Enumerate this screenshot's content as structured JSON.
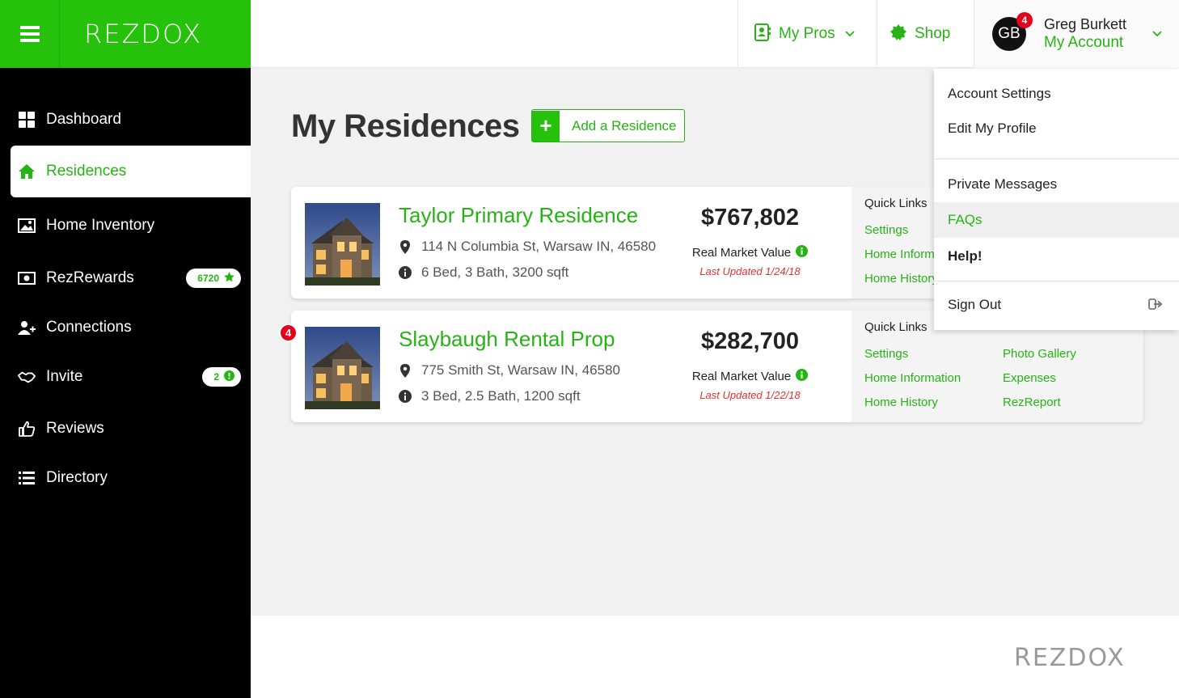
{
  "brand": {
    "logo": "REZDOX"
  },
  "header": {
    "my_pros": "My Pros",
    "shop": "Shop",
    "account": {
      "initials": "GB",
      "badge": "4",
      "name": "Greg Burkett",
      "sub": "My Account"
    }
  },
  "sidebar": {
    "items": [
      {
        "label": "Dashboard",
        "icon": "grid-icon"
      },
      {
        "label": "Residences",
        "icon": "home-icon",
        "active": true
      },
      {
        "label": "Home Inventory",
        "icon": "image-icon"
      },
      {
        "label": "RezRewards",
        "icon": "money-icon",
        "badge": "6720"
      },
      {
        "label": "Connections",
        "icon": "user-plus-icon"
      },
      {
        "label": "Invite",
        "icon": "handshake-icon",
        "badge": "2"
      },
      {
        "label": "Reviews",
        "icon": "thumbs-up-icon"
      },
      {
        "label": "Directory",
        "icon": "list-icon"
      }
    ]
  },
  "main": {
    "title": "My Residences",
    "add_button": "Add a Residence",
    "residences": [
      {
        "name": "Taylor Primary Residence",
        "address": "114 N Columbia St, Warsaw IN, 46580",
        "details": "6 Bed, 3 Bath, 3200 sqft",
        "price": "$767,802",
        "value_label": "Real Market Value",
        "updated": "Last Updated 1/24/18",
        "quick_links_title": "Quick Links",
        "links": [
          "Settings",
          "Home Inform",
          "Home History"
        ]
      },
      {
        "name": "Slaybaugh Rental Prop",
        "address": "775 Smith St, Warsaw IN, 46580",
        "details": "3 Bed, 2.5 Bath, 1200 sqft",
        "price": "$282,700",
        "value_label": "Real Market Value",
        "updated": "Last Updated 1/22/18",
        "quick_links_title": "Quick Links",
        "links": [
          "Settings",
          "Home Information",
          "Home History",
          "Photo Gallery",
          "Expenses",
          "RezReport"
        ],
        "notification": "4"
      }
    ]
  },
  "dropdown": {
    "items": [
      "Account Settings",
      "Edit My Profile",
      "Private Messages",
      "FAQs",
      "Help!",
      "Sign Out"
    ]
  },
  "footer": {
    "logo": "REZDOX"
  },
  "colors": {
    "brand_green": "#26c20b",
    "link_green": "#26b314",
    "alert_red": "#e5001b"
  }
}
